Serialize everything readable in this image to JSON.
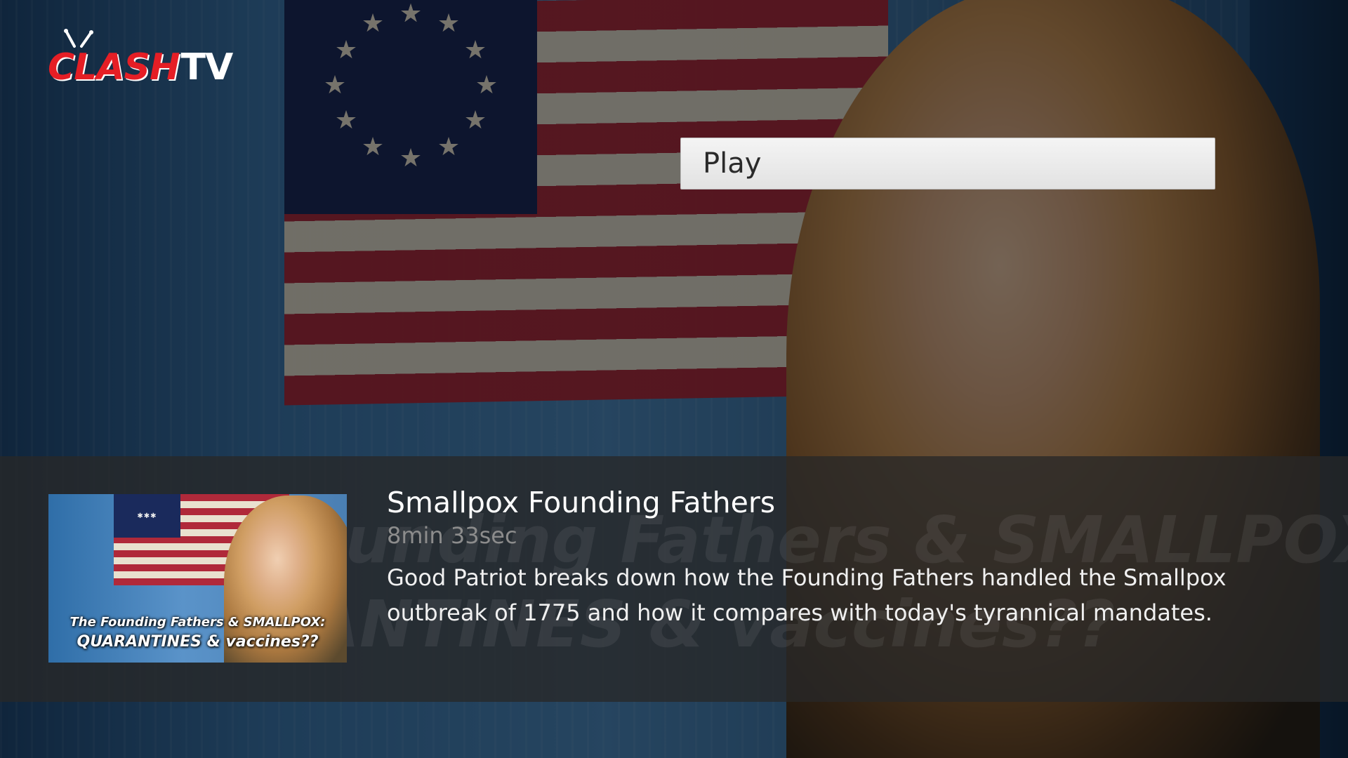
{
  "app": {
    "logo_clash": "CLASH",
    "logo_tv": "TV",
    "brand_color": "#e51e25"
  },
  "actions": {
    "play_label": "Play"
  },
  "video": {
    "title": "Smallpox Founding Fathers",
    "duration": "8min 33sec",
    "description": "Good Patriot breaks down how the Founding Fathers handled the Smallpox outbreak of 1775 and how it compares with today's tyrannical mandates.",
    "thumbnail_caption_line1": "The Founding Fathers & SMALLPOX:",
    "thumbnail_caption_line2": "QUARANTINES & vaccines??",
    "background_caption_line1": "The Founding Fathers & SMALLPOX:",
    "background_caption_line2": "QUARANTINES & vaccines??"
  }
}
